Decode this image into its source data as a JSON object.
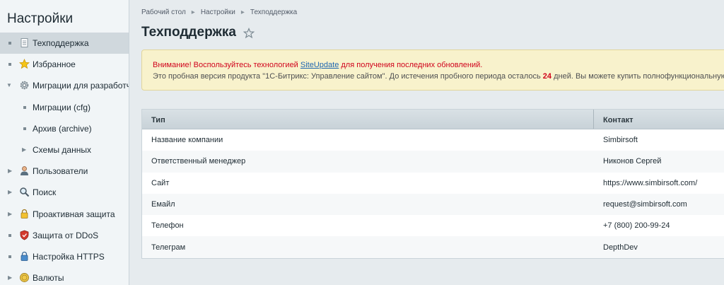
{
  "sidebar": {
    "title": "Настройки",
    "items": [
      {
        "label": "Техподдержка",
        "icon": "document-icon",
        "marker": "bullet",
        "active": true,
        "sub": false
      },
      {
        "label": "Избранное",
        "icon": "star-icon",
        "marker": "bullet",
        "active": false,
        "sub": false
      },
      {
        "label": "Миграции для разработчиков",
        "icon": "gear-icon",
        "marker": "arrow-down",
        "active": false,
        "sub": false
      },
      {
        "label": "Миграции (cfg)",
        "icon": "",
        "marker": "bullet",
        "active": false,
        "sub": true
      },
      {
        "label": "Архив (archive)",
        "icon": "",
        "marker": "bullet",
        "active": false,
        "sub": true
      },
      {
        "label": "Схемы данных",
        "icon": "",
        "marker": "arrow-right",
        "active": false,
        "sub": true
      },
      {
        "label": "Пользователи",
        "icon": "user-icon",
        "marker": "arrow-right",
        "active": false,
        "sub": false
      },
      {
        "label": "Поиск",
        "icon": "search-icon",
        "marker": "arrow-right",
        "active": false,
        "sub": false
      },
      {
        "label": "Проактивная защита",
        "icon": "lock-icon",
        "marker": "arrow-right",
        "active": false,
        "sub": false
      },
      {
        "label": "Защита от DDoS",
        "icon": "shield-icon",
        "marker": "bullet",
        "active": false,
        "sub": false
      },
      {
        "label": "Настройка HTTPS",
        "icon": "padlock-icon",
        "marker": "bullet",
        "active": false,
        "sub": false
      },
      {
        "label": "Валюты",
        "icon": "coin-icon",
        "marker": "arrow-right",
        "active": false,
        "sub": false
      }
    ]
  },
  "breadcrumb": [
    "Рабочий стол",
    "Настройки",
    "Техподдержка"
  ],
  "page": {
    "title": "Техподдержка"
  },
  "notice": {
    "line1_before": "Внимание! Воспользуйтесь технологией ",
    "line1_link": "SiteUpdate",
    "line1_after": " для получения последних обновлений.",
    "line2_before": "Это пробная версия продукта \"1С-Битрикс: Управление сайтом\". До истечения пробного периода осталось ",
    "line2_days": "24",
    "line2_after": " дней. Вы можете купить полнофункциональную"
  },
  "table": {
    "headers": [
      "Тип",
      "Контакт"
    ],
    "rows": [
      [
        "Название компании",
        "Simbirsoft"
      ],
      [
        "Ответственный менеджер",
        "Никонов Сергей"
      ],
      [
        "Сайт",
        "https://www.simbirsoft.com/"
      ],
      [
        "Емайл",
        "request@simbirsoft.com"
      ],
      [
        "Телефон",
        "+7 (800) 200-99-24"
      ],
      [
        "Телеграм",
        "DepthDev"
      ]
    ]
  },
  "colors": {
    "notice_red": "#d0021b",
    "link_blue": "#2067b0",
    "notice_bg": "#f8f2cc"
  }
}
